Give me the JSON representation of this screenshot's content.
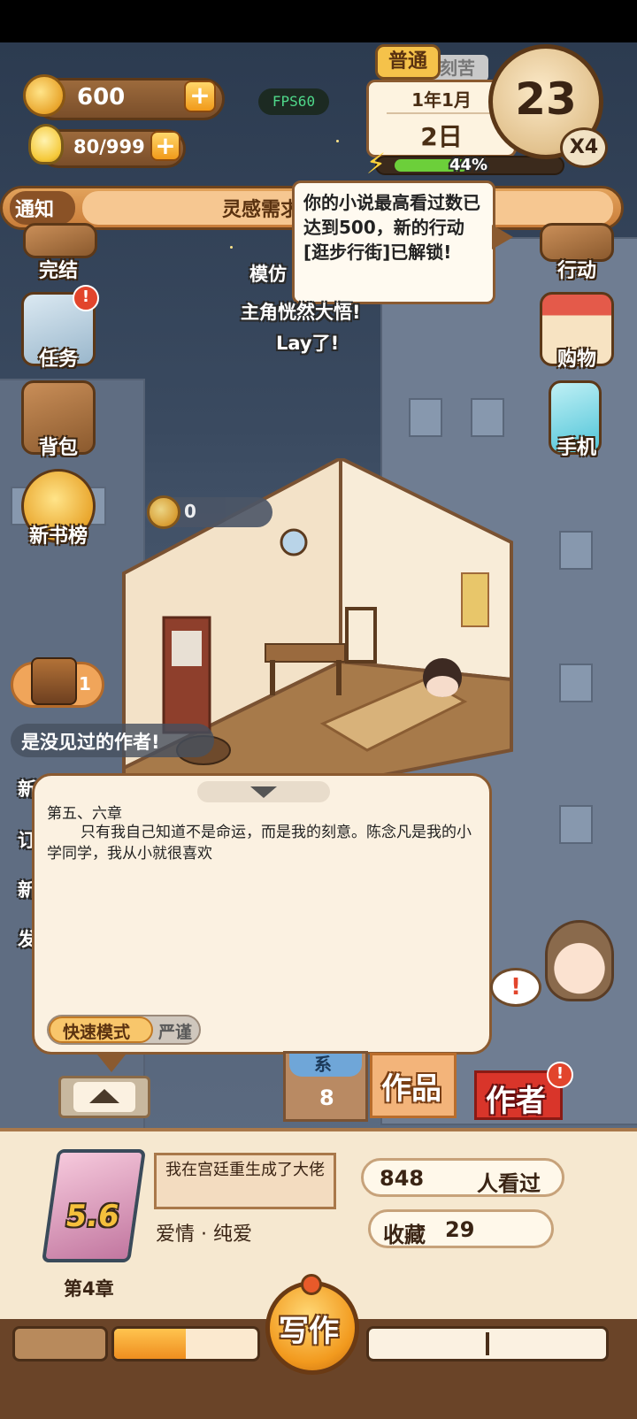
{
  "hud": {
    "coins": "600",
    "inspiration": "80/999",
    "fps": "FPS60",
    "mode_badge": "普通",
    "date_partial": "刻苦",
    "year_month": "1年1月",
    "day": "2日",
    "energy_percent": "44%",
    "energy_fraction": 0.44,
    "big_number": "23",
    "speed": "X4"
  },
  "notice": {
    "label": "通知",
    "text": "灵感需求"
  },
  "tooltip": {
    "text": "你的小说最高看过数已达到500，新的行动[逛步行街]已解锁!"
  },
  "floating_text": [
    "模仿",
    "主角恍然大悟!",
    "Lay了!"
  ],
  "left_menu": [
    {
      "label": "完结"
    },
    {
      "label": "任务"
    },
    {
      "label": "背包"
    },
    {
      "label": "新书榜"
    }
  ],
  "right_menu": [
    {
      "label": "行动"
    },
    {
      "label": "购物"
    },
    {
      "label": "手机"
    }
  ],
  "room_coins": "0",
  "treasure_count": "1",
  "chat_lines": [
    "是没见过的作者!"
  ],
  "chat_partials": [
    "新",
    "订",
    "新",
    "发"
  ],
  "writing_panel": {
    "chapter_title": "第五、六章",
    "body": "只有我自己知道不是命运，而是我的刻意。陈念凡是我的小学同学，我从小就很喜欢",
    "mode_fast": "快速模式",
    "mode_strict": "严谨"
  },
  "tabs": {
    "partial_label": "系",
    "count": "8",
    "works": "作品",
    "author": "作者"
  },
  "book": {
    "rating": "5.6",
    "title": "我在宫廷重生成了大佬",
    "genre": "爱情 · 纯爱",
    "chapter": "第4章",
    "views": "848",
    "views_label": "人看过",
    "favorites_label": "收藏",
    "favorites": "29"
  },
  "write_button": "写作",
  "bottom_progress": 0.5
}
